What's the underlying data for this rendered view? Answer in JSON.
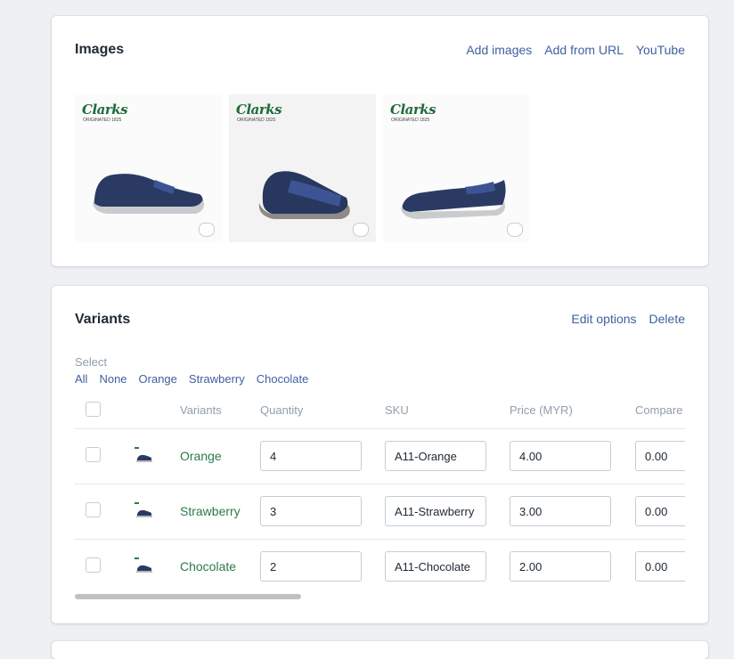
{
  "images_card": {
    "title": "Images",
    "actions": [
      "Add images",
      "Add from URL",
      "YouTube"
    ],
    "thumbnails": [
      {
        "brand": "Clarks",
        "brand_sub": "ORIGINATED 1825",
        "icon": "leather-badge-icon"
      },
      {
        "brand": "Clarks",
        "brand_sub": "ORIGINATED 1825",
        "icon": "leather-badge-icon"
      },
      {
        "brand": "Clarks",
        "brand_sub": "ORIGINATED 1825",
        "icon": "leather-badge-icon"
      }
    ]
  },
  "variants_card": {
    "title": "Variants",
    "actions": [
      "Edit options",
      "Delete"
    ],
    "select_label": "Select",
    "filters": [
      "All",
      "None",
      "Orange",
      "Strawberry",
      "Chocolate"
    ],
    "columns": [
      "Variants",
      "Quantity",
      "SKU",
      "Price (MYR)",
      "Compare"
    ],
    "rows": [
      {
        "name": "Orange",
        "quantity": "4",
        "sku": "A11-Orange",
        "price": "4.00",
        "compare": "0.00"
      },
      {
        "name": "Strawberry",
        "quantity": "3",
        "sku": "A11-Strawberry",
        "price": "3.00",
        "compare": "0.00"
      },
      {
        "name": "Chocolate",
        "quantity": "2",
        "sku": "A11-Chocolate",
        "price": "2.00",
        "compare": "0.00"
      }
    ]
  },
  "colors": {
    "link": "#3f5fa0",
    "variant_name": "#2c7a4b",
    "page_bg": "#eef0f3"
  }
}
